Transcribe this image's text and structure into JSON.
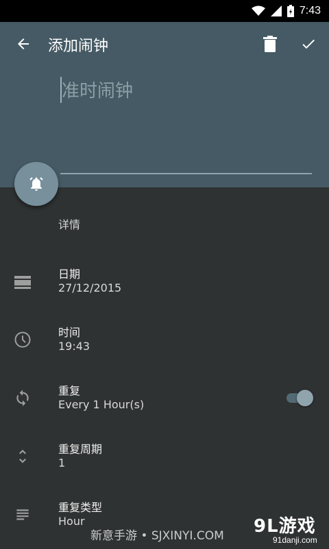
{
  "status_bar": {
    "time": "7:43"
  },
  "toolbar": {
    "title": "添加闹钟"
  },
  "alarm_name": {
    "value": "",
    "placeholder": "准时闹钟"
  },
  "details": {
    "section_label": "详情",
    "rows": [
      {
        "title": "日期",
        "value": "27/12/2015",
        "icon": "calendar-icon"
      },
      {
        "title": "时间",
        "value": "19:43",
        "icon": "clock-icon"
      },
      {
        "title": "重复",
        "value": "Every 1 Hour(s)",
        "icon": "repeat-icon",
        "toggle_on": true
      },
      {
        "title": "重复周期",
        "value": "1",
        "icon": "unfold-icon"
      },
      {
        "title": "重复类型",
        "value": "Hour",
        "icon": "subject-icon"
      }
    ]
  },
  "watermark": {
    "text": "新意手游 • SJXINYI.COM",
    "logo_main": "9L游戏",
    "logo_sub": "91danji.com"
  },
  "colors": {
    "header": "#455a64",
    "fab": "#78909c",
    "background": "#2f3232",
    "accent": "#90a4ae"
  }
}
